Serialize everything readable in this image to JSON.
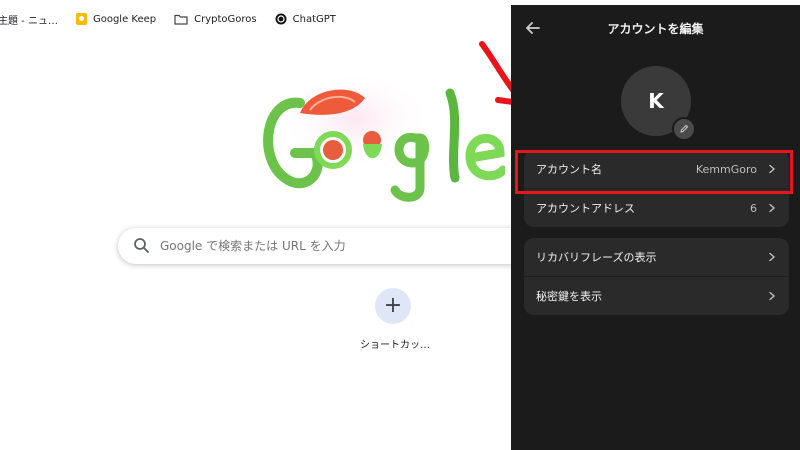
{
  "bookmarks": [
    {
      "label": "主題 - ニュ…",
      "icon": "none"
    },
    {
      "label": "Google Keep",
      "icon": "keep-icon"
    },
    {
      "label": "CryptoGoros",
      "icon": "folder-icon"
    },
    {
      "label": "ChatGPT",
      "icon": "chatgpt-icon"
    }
  ],
  "newtab": {
    "search_placeholder": "Google で検索または URL を入力",
    "shortcut_add_symbol": "+",
    "shortcut_label": "ショートカッ…",
    "doodle_alt": "Google"
  },
  "panel": {
    "title": "アカウントを編集",
    "avatar_letter": "K",
    "account_rows": [
      {
        "label": "アカウント名",
        "value": "KemmGoro"
      },
      {
        "label": "アカウントアドレス",
        "value": "6"
      }
    ],
    "security_rows": [
      {
        "label": "リカバリフレーズの表示"
      },
      {
        "label": "秘密鍵を表示"
      }
    ]
  },
  "colors": {
    "panel_bg": "#1b1b1b",
    "row_bg": "#2a2a2a",
    "highlight": "#e8151b",
    "arrow": "#e8151b"
  }
}
